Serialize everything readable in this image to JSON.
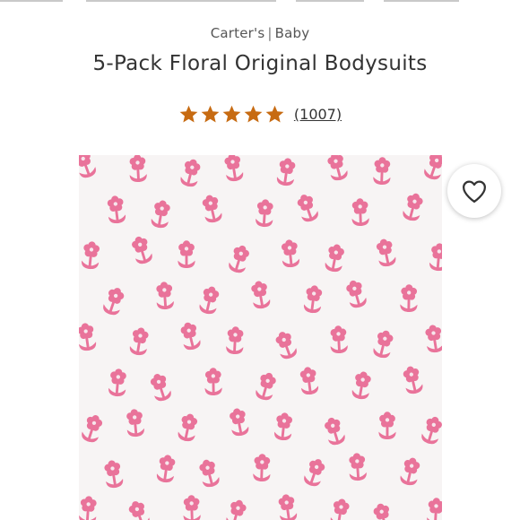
{
  "brand": {
    "name": "Carter's",
    "separator": "|",
    "category": "Baby"
  },
  "product": {
    "title": "5-Pack Floral Original Bodysuits"
  },
  "rating": {
    "stars": 5,
    "max_stars": 5,
    "count": "(1007)"
  },
  "colors": {
    "star": "#c76b12",
    "pattern_flower": "#e9739a",
    "pattern_background": "#f7f4f4"
  },
  "icons": {
    "favorite": "heart-outline-icon",
    "star": "star-icon"
  }
}
